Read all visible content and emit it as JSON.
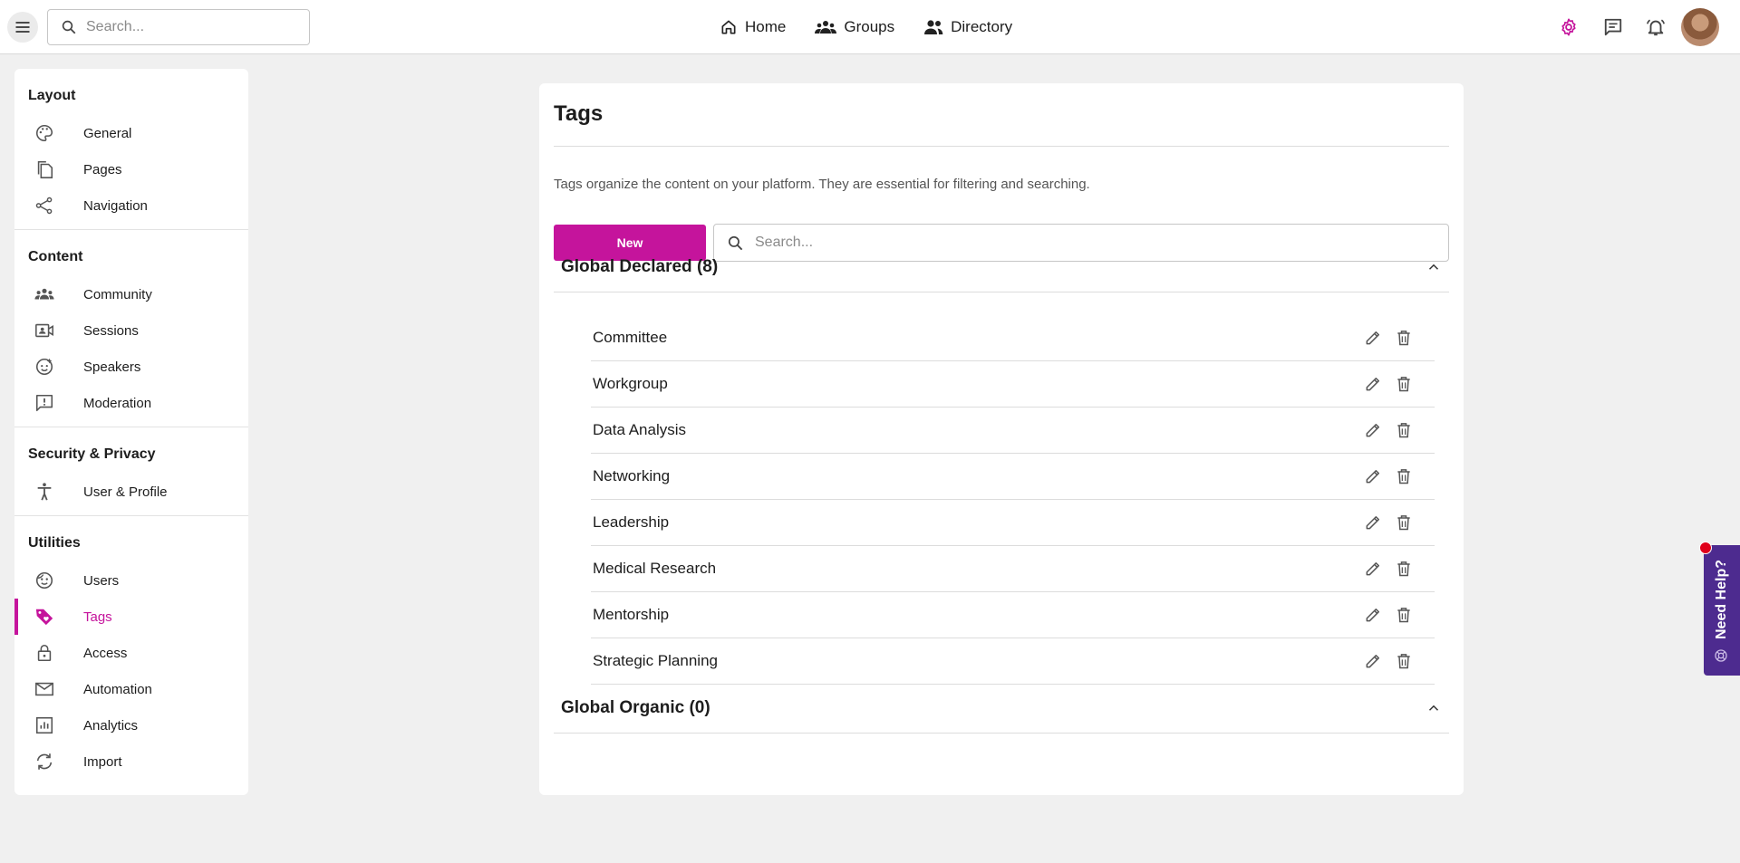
{
  "topbar": {
    "search_placeholder": "Search...",
    "nav": [
      {
        "label": "Home",
        "icon": "home-icon"
      },
      {
        "label": "Groups",
        "icon": "groups-icon"
      },
      {
        "label": "Directory",
        "icon": "directory-icon"
      }
    ],
    "icons": [
      "settings-icon",
      "chat-icon",
      "notifications-icon"
    ],
    "accent": "#c5149c"
  },
  "sidebar": {
    "sections": [
      {
        "title": "Layout",
        "items": [
          {
            "label": "General",
            "icon": "palette-icon"
          },
          {
            "label": "Pages",
            "icon": "pages-icon"
          },
          {
            "label": "Navigation",
            "icon": "share-icon"
          }
        ]
      },
      {
        "title": "Content",
        "items": [
          {
            "label": "Community",
            "icon": "community-icon"
          },
          {
            "label": "Sessions",
            "icon": "video-icon"
          },
          {
            "label": "Speakers",
            "icon": "speaker-face-icon"
          },
          {
            "label": "Moderation",
            "icon": "report-icon"
          }
        ]
      },
      {
        "title": "Security & Privacy",
        "items": [
          {
            "label": "User & Profile",
            "icon": "accessibility-icon"
          }
        ]
      },
      {
        "title": "Utilities",
        "items": [
          {
            "label": "Users",
            "icon": "users-face-icon"
          },
          {
            "label": "Tags",
            "icon": "tag-icon",
            "active": true
          },
          {
            "label": "Access",
            "icon": "lock-icon"
          },
          {
            "label": "Automation",
            "icon": "mail-icon"
          },
          {
            "label": "Analytics",
            "icon": "analytics-icon"
          },
          {
            "label": "Import",
            "icon": "sync-icon"
          }
        ]
      }
    ]
  },
  "main": {
    "title": "Tags",
    "description": "Tags organize the content on your platform. They are essential for filtering and searching.",
    "new_label": "New",
    "search_placeholder": "Search...",
    "groups": [
      {
        "title": "Global Declared (8)",
        "expanded": true,
        "tags": [
          "Committee",
          "Workgroup",
          "Data Analysis",
          "Networking",
          "Leadership",
          "Medical Research",
          "Mentorship",
          "Strategic Planning"
        ]
      },
      {
        "title": "Global Organic (0)",
        "expanded": true,
        "tags": []
      }
    ]
  },
  "help": {
    "label": "Need Help?",
    "color": "#4d2b8f"
  }
}
